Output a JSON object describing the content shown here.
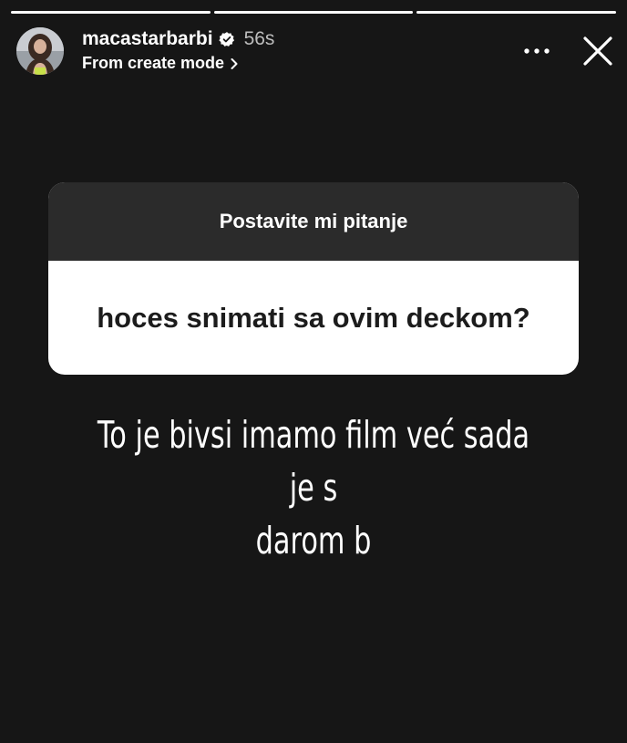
{
  "story": {
    "segments_count": 3
  },
  "header": {
    "username": "macastarbarbi",
    "time": "56s",
    "subtitle": "From create mode",
    "icons": {
      "verified": "verified-badge-icon",
      "chevron": "chevron-right-icon",
      "more": "more-options-icon",
      "close": "close-icon"
    }
  },
  "question_sticker": {
    "title": "Postavite mi pitanje",
    "question": "hoces snimati sa ovim deckom?"
  },
  "caption": {
    "line1": "To je bivsi imamo film već sada je s",
    "line2": "darom b"
  },
  "colors": {
    "background": "#161616",
    "sticker_header": "#2b2b2b",
    "sticker_body": "#ffffff"
  }
}
